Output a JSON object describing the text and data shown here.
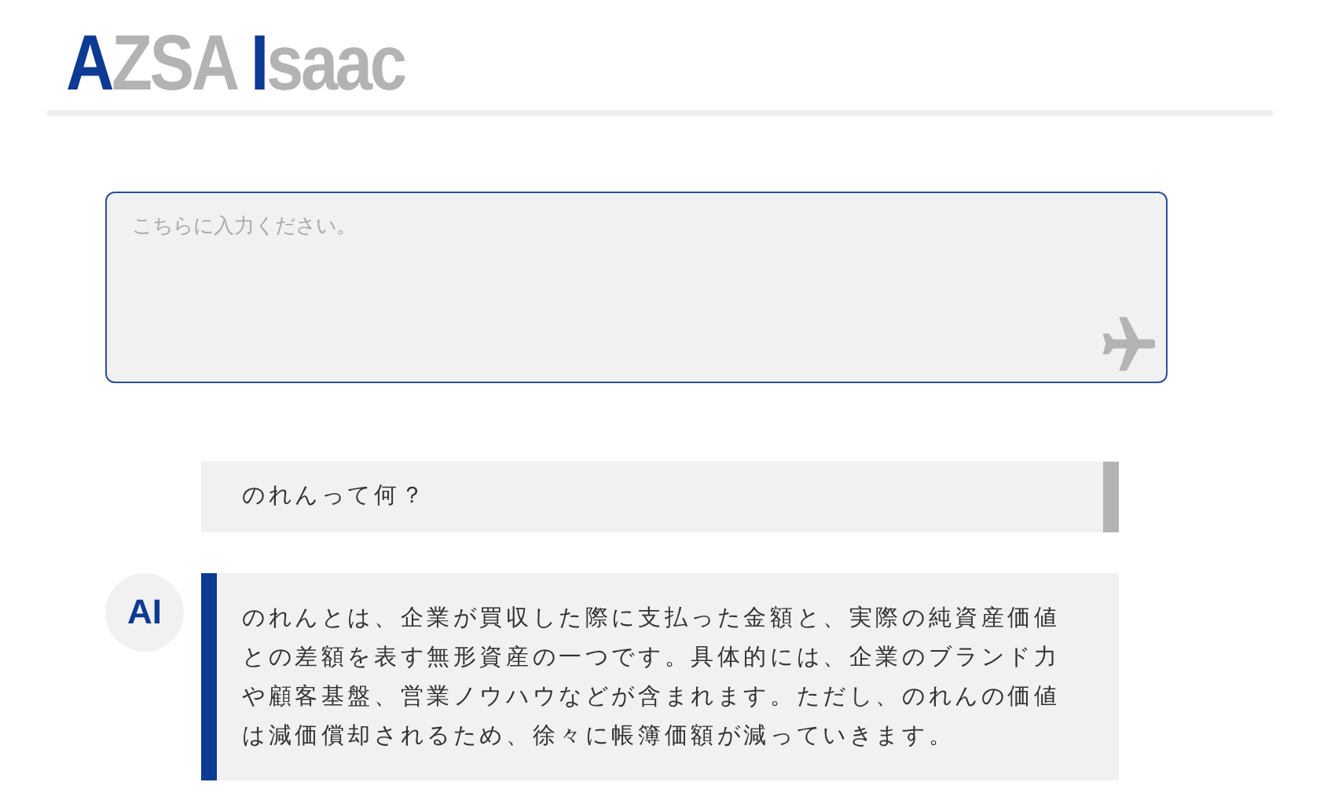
{
  "logo": [
    {
      "text": "A",
      "accent": true
    },
    {
      "text": "ZSA ",
      "accent": false
    },
    {
      "text": "I",
      "accent": true
    },
    {
      "text": "saac",
      "accent": false
    }
  ],
  "prompt": {
    "placeholder": "こちらに入力ください。"
  },
  "messages": [
    {
      "kind": "user",
      "text": "のれんって何？"
    },
    {
      "kind": "ai",
      "avatar": "AI",
      "text": "のれんとは、企業が買収した際に支払った金額と、実際の純資産価値との差額を表す無形資産の一つです。具体的には、企業のブランド力や顧客基盤、営業ノウハウなどが含まれます。ただし、のれんの価値は減価償却されるため、徐々に帳簿価額が減っていきます。"
    }
  ]
}
